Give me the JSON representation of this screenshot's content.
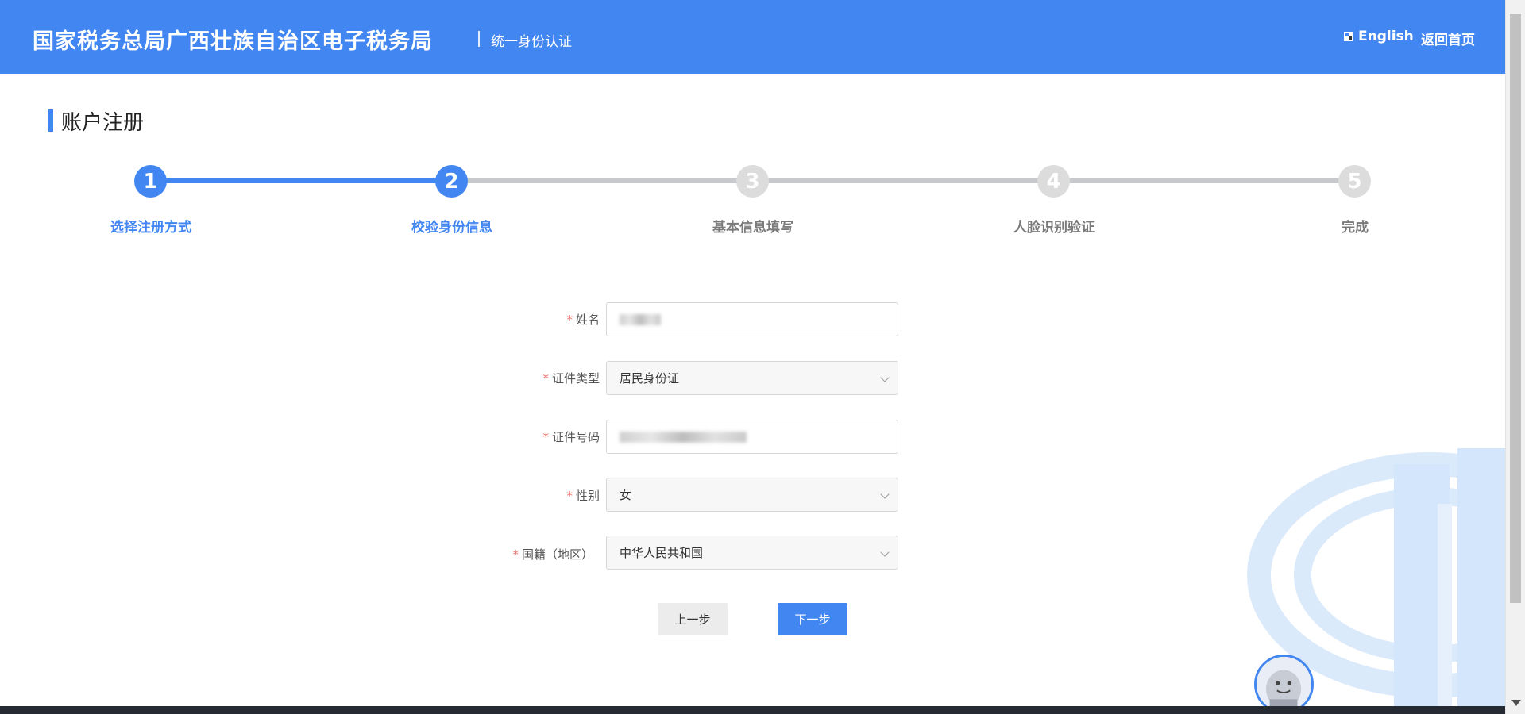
{
  "header": {
    "brand": "国家税务总局广西壮族自治区电子税务局",
    "subtitle": "统一身份认证",
    "language_link": "English",
    "home_link": "返回首页"
  },
  "page": {
    "title": "账户注册"
  },
  "steps": [
    {
      "number": "1",
      "label": "选择注册方式",
      "state": "done"
    },
    {
      "number": "2",
      "label": "校验身份信息",
      "state": "active"
    },
    {
      "number": "3",
      "label": "基本信息填写",
      "state": "pending"
    },
    {
      "number": "4",
      "label": "人脸识别验证",
      "state": "pending"
    },
    {
      "number": "5",
      "label": "完成",
      "state": "pending"
    }
  ],
  "form": {
    "required_mark": "*",
    "name": {
      "label": "姓名"
    },
    "id_type": {
      "label": "证件类型",
      "value": "居民身份证"
    },
    "id_number": {
      "label": "证件号码"
    },
    "gender": {
      "label": "性别",
      "value": "女"
    },
    "nationality": {
      "label": "国籍（地区）",
      "value": "中华人民共和国"
    }
  },
  "buttons": {
    "prev": "上一步",
    "next": "下一步"
  },
  "colors": {
    "accent": "#4286f2",
    "inactive": "#dcdcdc",
    "required": "#f56c6c"
  },
  "icons": {
    "language": "language-flag-icon",
    "dropdown": "chevron-down-icon",
    "assistant": "assistant-avatar-icon"
  }
}
